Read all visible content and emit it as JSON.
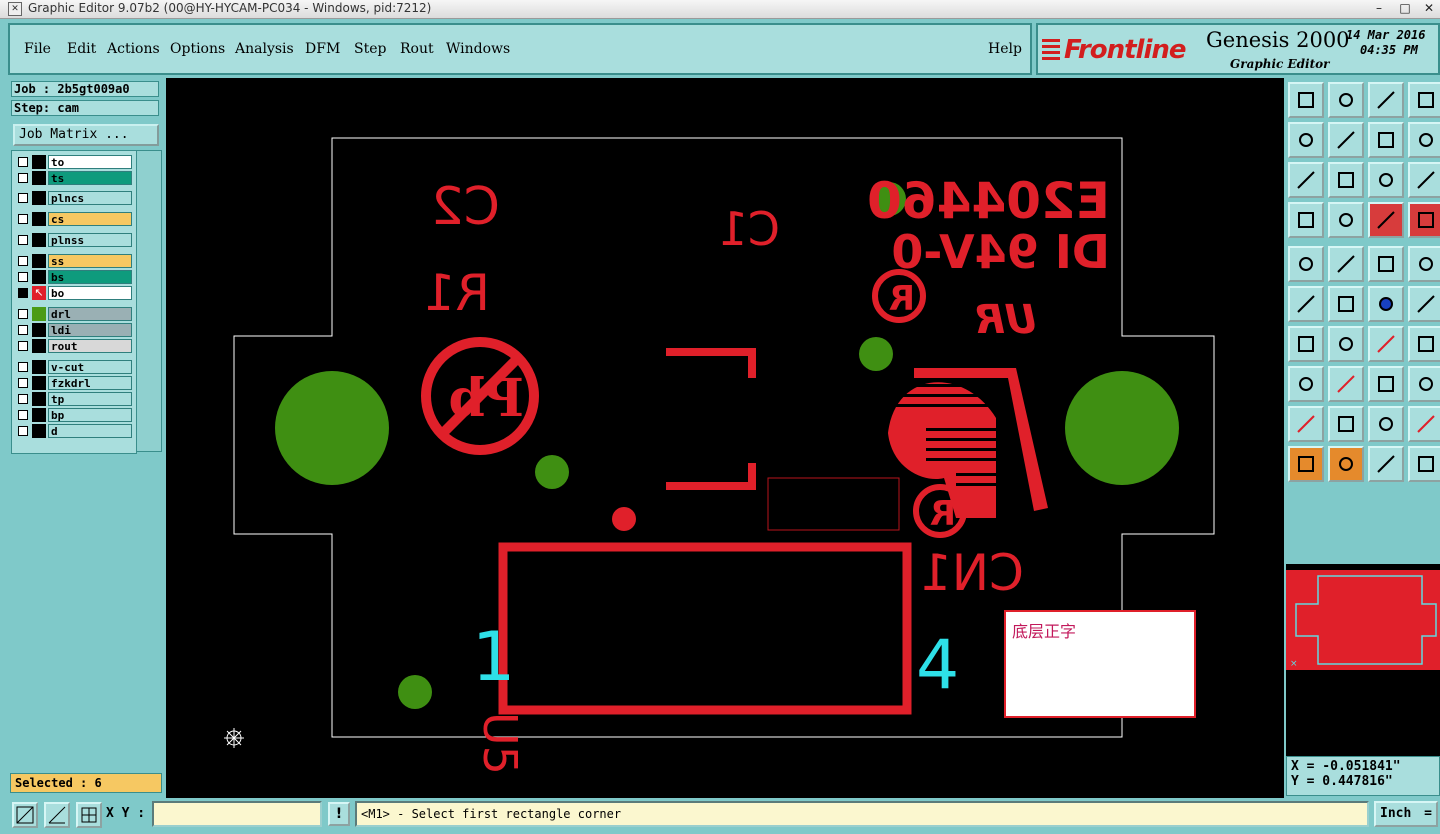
{
  "window": {
    "title": "Graphic Editor 9.07b2 (00@HY-HYCAM-PC034 - Windows, pid:7212)",
    "controls": [
      "–",
      "□",
      "✕"
    ]
  },
  "menu": [
    "File",
    "Edit",
    "Actions",
    "Options",
    "Analysis",
    "DFM",
    "Step",
    "Rout",
    "Windows"
  ],
  "help_label": "Help",
  "brand": {
    "logo": "Frontline",
    "product": "Genesis 2000",
    "subtitle": "Graphic Editor",
    "date": "14 Mar 2016",
    "time": "04:35 PM"
  },
  "job": {
    "job_label": "Job : 2b5gt009a0",
    "step_label": "Step: cam",
    "matrix_button": "Job Matrix ..."
  },
  "layers": [
    {
      "name": "to",
      "color": "#ffffff",
      "mark": "#000000"
    },
    {
      "name": "ts",
      "color": "#0e9b7d",
      "mark": "#000000"
    },
    {
      "name": "plncs",
      "color": "#a9dedd",
      "mark": "#000000"
    },
    {
      "name": "cs",
      "color": "#f6c862",
      "mark": "#000000"
    },
    {
      "name": "plnss",
      "color": "#a9dedd",
      "mark": "#000000"
    },
    {
      "name": "ss",
      "color": "#f6c862",
      "mark": "#000000"
    },
    {
      "name": "bs",
      "color": "#0e9b7d",
      "mark": "#000000"
    },
    {
      "name": "bo",
      "color": "#ffffff",
      "mark": "#e0202a",
      "active": true
    },
    {
      "name": "drl",
      "color": "#9ab0b4",
      "mark": "#4b9b16"
    },
    {
      "name": "ldi",
      "color": "#9ab0b4",
      "mark": "#000000"
    },
    {
      "name": "rout",
      "color": "#d8d8d8",
      "mark": "#000000"
    },
    {
      "name": "v-cut",
      "color": "#a9dedd",
      "mark": "#000000"
    },
    {
      "name": "fzkdrl",
      "color": "#a9dedd",
      "mark": "#000000"
    },
    {
      "name": "tp",
      "color": "#a9dedd",
      "mark": "#000000"
    },
    {
      "name": "bp",
      "color": "#a9dedd",
      "mark": "#000000"
    },
    {
      "name": "d",
      "color": "#a9dedd",
      "mark": "#000000"
    }
  ],
  "selected_label": "Selected : 6",
  "board": {
    "silk_labels": [
      "C2",
      "C1",
      "R1",
      "E204460",
      "DI 94V-0",
      "U5",
      "CN1"
    ],
    "pin_labels": [
      "1",
      "4"
    ],
    "note_text": "底层正字",
    "colors": {
      "silk": "#e0202a",
      "copper": "#3f8f12",
      "pin": "#2ee0e8",
      "outline": "#ffffff"
    }
  },
  "coords": {
    "x": "X = -0.051841\"",
    "y": "Y = 0.447816\""
  },
  "status": {
    "xy_label": "X Y :",
    "xy_value": "",
    "bang": "!",
    "prompt": "<M1> - Select first rectangle corner",
    "units": "Inch"
  }
}
